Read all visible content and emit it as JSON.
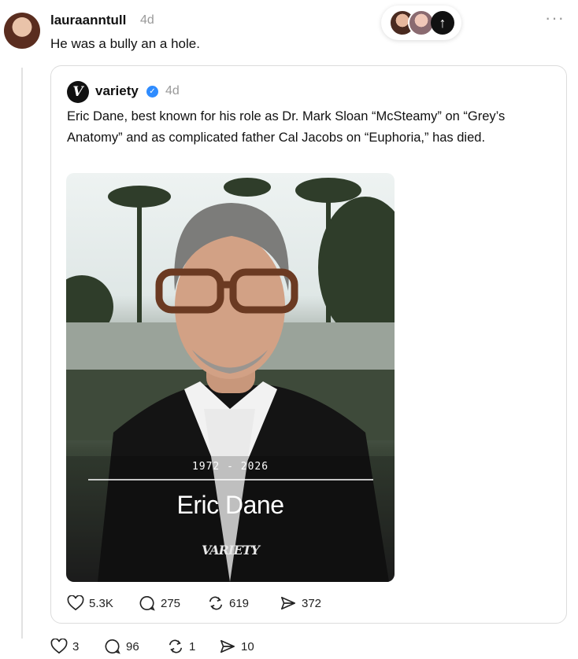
{
  "post": {
    "username": "lauraanntull",
    "time": "4d",
    "text": "He was a bully an a hole.",
    "more_label": "···",
    "stats": {
      "likes": "3",
      "replies": "96",
      "reposts": "1",
      "shares": "10"
    }
  },
  "quoted": {
    "username": "variety",
    "time": "4d",
    "logo_letter": "V",
    "text": "Eric Dane, best known for his role as Dr. Mark Sloan “McSteamy” on “Grey’s Anatomy” and as complicated father Cal Jacobs on “Euphoria,” has died.",
    "image": {
      "years": "1972 - 2026",
      "name": "Eric Dane",
      "brand": "VARIETY"
    },
    "stats": {
      "likes": "5.3K",
      "replies": "275",
      "reposts": "619",
      "shares": "372"
    }
  },
  "icons": {
    "like": "heart-icon",
    "reply": "comment-icon",
    "repost": "repost-icon",
    "share": "send-icon",
    "verified": "verified-badge-icon",
    "scroll_up": "arrow-up-icon"
  },
  "colors": {
    "verified": "#2f8cff",
    "muted": "#9a9a9a"
  }
}
